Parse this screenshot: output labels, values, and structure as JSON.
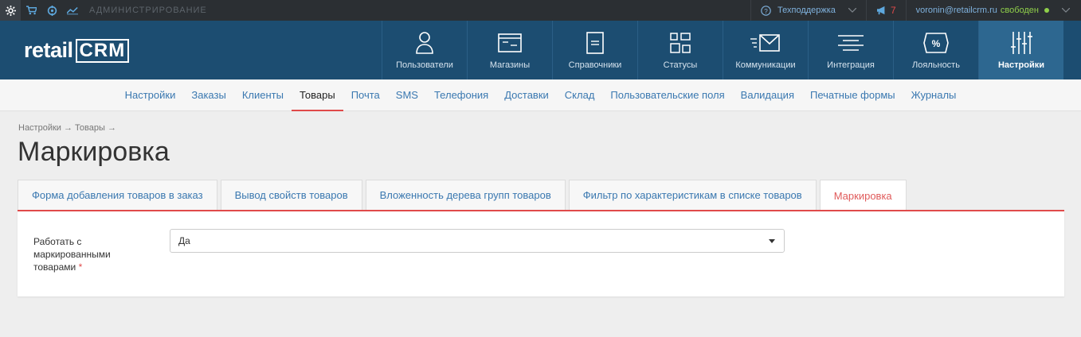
{
  "topbar": {
    "admin_label": "Администрирование",
    "support": "Техподдержка",
    "notifications_count": "7",
    "email": "voronin@retailcrm.ru",
    "status": "свободен"
  },
  "logo": {
    "text_left": "retail",
    "text_right": "CRM"
  },
  "main_nav": [
    {
      "label": "Пользователи",
      "icon": "user-icon"
    },
    {
      "label": "Магазины",
      "icon": "store-window-icon"
    },
    {
      "label": "Справочники",
      "icon": "book-icon"
    },
    {
      "label": "Статусы",
      "icon": "status-grid-icon"
    },
    {
      "label": "Коммуникации",
      "icon": "mail-icon"
    },
    {
      "label": "Интеграция",
      "icon": "integration-lines-icon"
    },
    {
      "label": "Лояльность",
      "icon": "percent-tag-icon"
    },
    {
      "label": "Настройки",
      "icon": "sliders-icon"
    }
  ],
  "sub_nav": [
    "Настройки",
    "Заказы",
    "Клиенты",
    "Товары",
    "Почта",
    "SMS",
    "Телефония",
    "Доставки",
    "Склад",
    "Пользовательские поля",
    "Валидация",
    "Печатные формы",
    "Журналы"
  ],
  "breadcrumb": "Настройки → Товары →",
  "page_title": "Маркировка",
  "tabs": [
    "Форма добавления товаров в заказ",
    "Вывод свойств товаров",
    "Вложенность дерева групп товаров",
    "Фильтр по характеристикам в списке товаров",
    "Маркировка"
  ],
  "form": {
    "label": "Работать с маркированными товарами",
    "required_mark": "*",
    "select_value": "Да"
  },
  "colors": {
    "header_bg": "#1c4d71",
    "accent_red": "#e04a4a",
    "link_blue": "#3a78b0"
  }
}
